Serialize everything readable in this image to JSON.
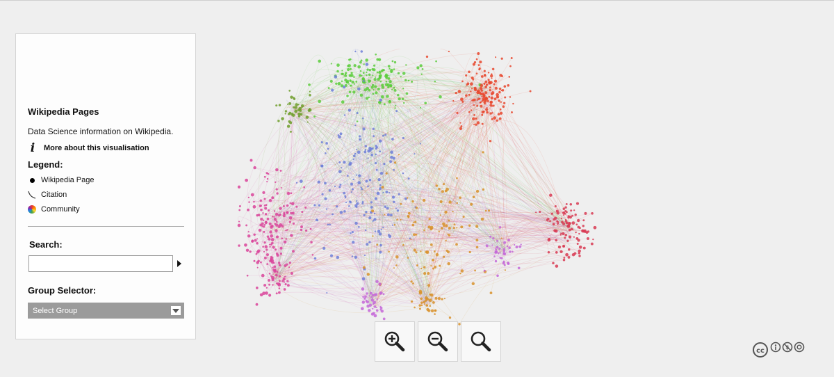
{
  "panel": {
    "title": "Wikipedia Pages",
    "description": "Data Science information on Wikipedia.",
    "more_link": "More about this visualisation",
    "legend_heading": "Legend:",
    "legend": [
      {
        "label": "Wikipedia Page",
        "icon": "node-dot-icon"
      },
      {
        "label": "Citation",
        "icon": "edge-curve-icon"
      },
      {
        "label": "Community",
        "icon": "color-wheel-icon"
      }
    ],
    "search_heading": "Search:",
    "search_value": "",
    "search_placeholder": "",
    "group_heading": "Group Selector:",
    "group_selected": "Select Group"
  },
  "zoom": {
    "buttons": [
      "zoom-in-icon",
      "zoom-out-icon",
      "zoom-reset-icon"
    ]
  },
  "license": {
    "icon": "creative-commons-icon"
  },
  "colors": {
    "green": "#5ccc3c",
    "olive": "#6f9e2a",
    "red": "#e8452c",
    "crimson": "#d83a52",
    "pink": "#d9449a",
    "blue": "#6f7fd8",
    "orange": "#d8902a",
    "violet": "#c467d8",
    "panel_select": "#9b9b9b",
    "background": "#efefef"
  }
}
